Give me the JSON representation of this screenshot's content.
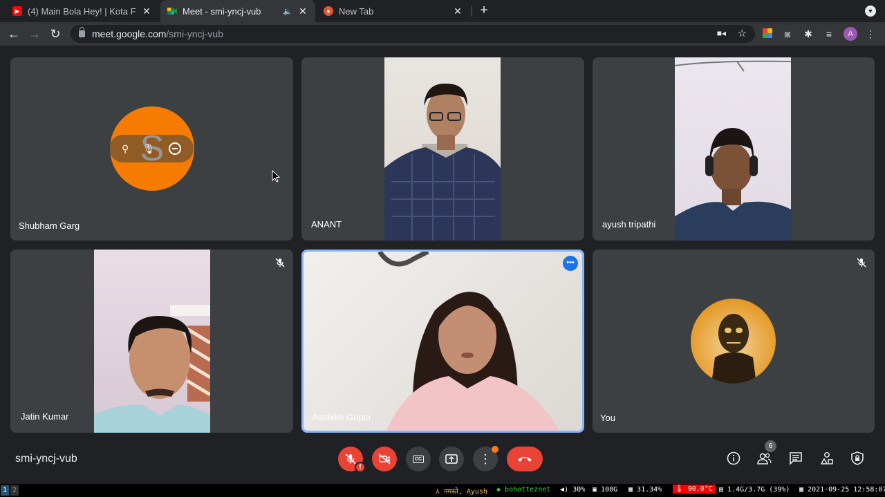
{
  "browser": {
    "tabs": [
      {
        "title": "(4) Main Bola Hey! | Kota F",
        "icon": "youtube-icon",
        "color": "#ff0000"
      },
      {
        "title": "Meet - smi-yncj-vub",
        "icon": "meet-icon",
        "color": "#00897b"
      },
      {
        "title": "New Tab",
        "icon": "duckduckgo-icon",
        "color": "#de5833"
      }
    ],
    "url_domain": "meet.google.com",
    "url_path": "/smi-yncj-vub",
    "profile_initial": "A"
  },
  "meet": {
    "meeting_code": "smi-yncj-vub",
    "participants": [
      {
        "name": "Shubham Garg",
        "initial": "S",
        "muted": false
      },
      {
        "name": "ANANT",
        "muted": false
      },
      {
        "name": "ayush tripathi",
        "muted": false
      },
      {
        "name": "Jatin Kumar",
        "muted": true
      },
      {
        "name": "Aashika Gupta",
        "muted": false,
        "speaking": true
      },
      {
        "name": "You",
        "muted": true
      }
    ],
    "participant_count": "6",
    "more_options_label": "•••",
    "mic_alert": "!"
  },
  "statusbar": {
    "workspaces": [
      "1",
      "2"
    ],
    "greeting": "नमस्ते, Ayush",
    "network": "bohotteznet",
    "volume": "30%",
    "disk": "108G",
    "cpu": "31.34%",
    "temp": "90.0°C",
    "memory": "1.4G/3.7G (39%)",
    "datetime": "2021-09-25 12:58:07"
  },
  "colors": {
    "accent": "#8ab4f8",
    "danger": "#ea4335",
    "avatar_orange": "#f57c00",
    "temp_red": "#ff0000",
    "net_green": "#36d83b"
  }
}
